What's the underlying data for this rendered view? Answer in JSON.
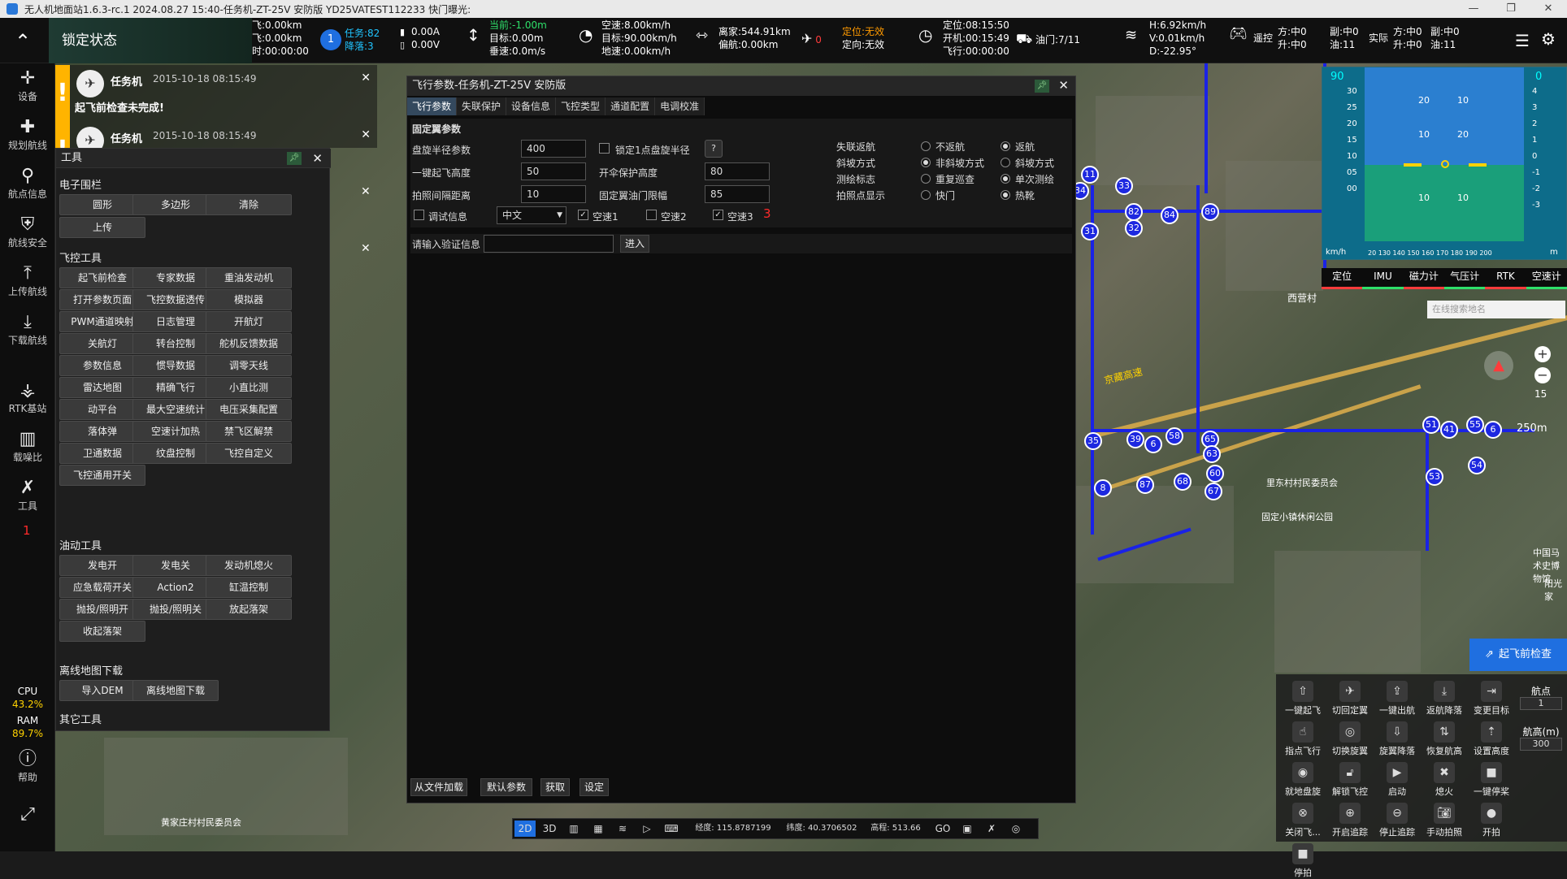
{
  "titlebar": {
    "text": "无人机地面站1.6.3-rc.1 2024.08.27 15:40-任务机-ZT-25V 安防版 YD25VATEST112233 快门曝光:"
  },
  "lock": {
    "label": "锁定状态"
  },
  "top": {
    "dist_flown": "已飞:0.00km",
    "dist_remaining": "待飞:0.00km",
    "time_used": "耗时:00:00:00",
    "task_badge": "1",
    "task_count": "任务:82",
    "landing": "降落:3",
    "current_a": "0.00A",
    "voltage": "0.00V",
    "alt_current": "当前:-1.00m",
    "alt_target": "目标:0.00m",
    "alt_vspeed": "垂速:0.0m/s",
    "airspeed": "空速:8.00km/h",
    "target_speed": "目标:90.00km/h",
    "ground_speed": "地速:0.00km/h",
    "home_dist": "离家:544.91km",
    "offset": "偏航:0.00km",
    "rtk_count": "0",
    "pos_status": "定位:无效",
    "heading_status": "定向:无效",
    "pos_time": "定位:08:15:50",
    "boot_time": "开机:00:15:49",
    "flight_time": "飞行:00:00:00",
    "throttle": "油门:7/11",
    "h_speed": "H:6.92km/h",
    "v_speed": "V:0.01km/h",
    "d_angle": "D:-22.95°",
    "remote_label": "遥控",
    "remote_dir": "方:中0",
    "remote_lift": "升:中0",
    "remote_aux": "副:中0",
    "remote_oil": "油:11",
    "actual_label": "实际",
    "actual_dir": "方:中0",
    "actual_lift": "升:中0",
    "actual_aux": "副:中0",
    "actual_oil": "油:11"
  },
  "leftbar": {
    "items": [
      "设备",
      "规划航线",
      "航点信息",
      "航线安全",
      "上传航线",
      "下载航线",
      "RTK基站",
      "载噪比",
      "工具"
    ],
    "tools_mark": "1",
    "cpu_label": "CPU",
    "cpu_value": "43.2%",
    "ram_label": "RAM",
    "ram_value": "89.7%",
    "help": "帮助"
  },
  "notices": [
    {
      "name": "任务机",
      "time": "2015-10-18 08:15:49",
      "message": "起飞前检查未完成!"
    },
    {
      "name": "任务机",
      "time": "2015-10-18 08:15:49",
      "message": ""
    }
  ],
  "tools": {
    "title": "工具",
    "sec_fence": "电子围栏",
    "fence": [
      "圆形",
      "多边形",
      "清除",
      "上传"
    ],
    "sec_fc": "飞控工具",
    "fc": [
      "起飞前检查",
      "专家数据",
      "重油发动机",
      "打开参数页面",
      "飞控数据透传",
      "模拟器",
      "PWM通道映射",
      "日志管理",
      "开航灯",
      "关航灯",
      "转台控制",
      "舵机反馈数据",
      "参数信息",
      "惯导数据",
      "调零天线",
      "雷达地图",
      "精确飞行",
      "小直比测",
      "动平台",
      "最大空速统计",
      "电压采集配置",
      "落体弹",
      "空速计加热",
      "禁飞区解禁",
      "卫通数据",
      "纹盘控制",
      "飞控自定义",
      "飞控通用开关"
    ],
    "fc_mark": "2",
    "sec_oil": "油动工具",
    "oil": [
      "发电开",
      "发电关",
      "发动机熄火",
      "应急载荷开关",
      "Action2",
      "缸温控制",
      "抛投/照明开",
      "抛投/照明关",
      "放起落架",
      "收起落架"
    ],
    "sec_map": "离线地图下载",
    "mapbtns": [
      "导入DEM",
      "离线地图下载"
    ],
    "sec_other": "其它工具"
  },
  "params": {
    "title": "飞行参数-任务机-ZT-25V 安防版",
    "tabs": [
      "飞行参数",
      "失联保护",
      "设备信息",
      "飞控类型",
      "通道配置",
      "电调校准"
    ],
    "section": "固定翼参数",
    "labels": {
      "hover_radius": "盘旋半径参数",
      "lock_hover": "锁定1点盘旋半径",
      "takeoff_alt": "一键起飞高度",
      "parachute_alt": "开伞保护高度",
      "photo_interval": "拍照间隔距离",
      "throttle_limit": "固定翼油门限幅",
      "debug": "调试信息",
      "speed1": "空速1",
      "speed2": "空速2",
      "speed3": "空速3",
      "auth": "请输入验证信息",
      "enter": "进入"
    },
    "values": {
      "hover_radius": "400",
      "takeoff_alt": "50",
      "parachute_alt": "80",
      "photo_interval": "10",
      "throttle_limit": "85",
      "language": "中文",
      "help": "?",
      "mark3": "3"
    },
    "right": {
      "lost_return": "失联返航",
      "slope": "斜坡方式",
      "survey": "测绘标志",
      "photo_display": "拍照点显示",
      "opt_no_return": "不返航",
      "opt_return": "返航",
      "opt_no_slope": "非斜坡方式",
      "opt_slope": "斜坡方式",
      "opt_repeat": "重复巡查",
      "opt_single": "单次测绘",
      "opt_shutter": "快门",
      "opt_hotshoe": "热靴"
    },
    "footer": [
      "从文件加载",
      "默认参数",
      "获取",
      "设定"
    ]
  },
  "hud": {
    "speed_top": "90",
    "alt_top": "0",
    "left_scale": [
      "30",
      "25",
      "20",
      "15",
      "10",
      "05",
      "00"
    ],
    "right_scale": [
      "4",
      "3",
      "2",
      "1",
      "0",
      "-1",
      "-2",
      "-3"
    ],
    "pitch": [
      "20",
      "10",
      "10",
      "20",
      "10",
      "10"
    ],
    "unit_left": "km/h",
    "unit_right": "m",
    "roll_scale": "20 130 140 150 160 170 180 190 200",
    "speed_mark": "0",
    "alt_mark": "0"
  },
  "status": [
    "定位",
    "IMU",
    "磁力计",
    "气压计",
    "RTK",
    "空速计"
  ],
  "map": {
    "search_placeholder": "在线搜索地名",
    "scale": "250m",
    "zoom_level": "15",
    "road_label": "京藏高速",
    "village1": "西营村",
    "village2": "厂",
    "label1": "里东村村民委员会",
    "label2": "中国马术史博物馆",
    "label3": "固定小镇休闲公园",
    "label4": "黄家庄村村民委员会",
    "label5": "阳光家",
    "waypoints": [
      "11",
      "34",
      "33",
      "82",
      "84",
      "89",
      "31",
      "32",
      "35",
      "39",
      "6",
      "58",
      "65",
      "63",
      "60",
      "68",
      "67",
      "8",
      "87",
      "51",
      "41",
      "55",
      "6",
      "54",
      "53"
    ],
    "preflight": "起飞前检查"
  },
  "actions": {
    "labels": [
      "一键起飞",
      "切回定翼",
      "一键出航",
      "返航降落",
      "变更目标",
      "指点飞行",
      "切换旋翼",
      "旋翼降落",
      "恢复航高",
      "设置高度",
      "就地盘旋",
      "解锁飞控",
      "启动",
      "熄火",
      "一键停桨",
      "关闭飞...",
      "开启追踪",
      "停止追踪",
      "手动拍照",
      "开拍",
      "停拍"
    ],
    "waypoint_label": "航点",
    "waypoint_value": "1",
    "alt_label": "航高(m)",
    "alt_value": "300"
  },
  "bottom": {
    "btn2d": "2D",
    "btn3d": "3D",
    "lon": "经度: 115.8787199",
    "lat": "纬度: 40.3706502",
    "elev": "高程: 513.66",
    "go": "GO"
  }
}
